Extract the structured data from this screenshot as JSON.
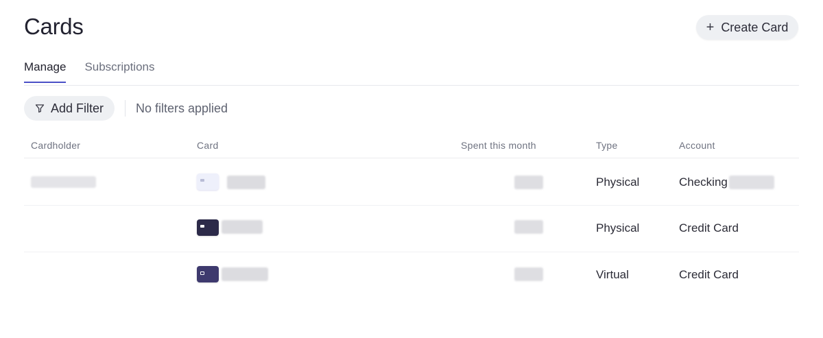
{
  "page": {
    "title": "Cards"
  },
  "header": {
    "create_button": {
      "label": "Create Card",
      "icon": "plus-icon"
    }
  },
  "tabs": [
    {
      "label": "Manage",
      "active": true
    },
    {
      "label": "Subscriptions",
      "active": false
    }
  ],
  "filters": {
    "add_filter_label": "Add Filter",
    "icon": "filter-icon",
    "status": "No filters applied"
  },
  "table": {
    "columns": [
      "Cardholder",
      "Card",
      "Spent this month",
      "Type",
      "Account"
    ],
    "rows": [
      {
        "cardholder": "",
        "card_style": "light",
        "type": "Physical",
        "account": "Checking"
      },
      {
        "cardholder": "",
        "card_style": "dark",
        "type": "Physical",
        "account": "Credit Card"
      },
      {
        "cardholder": "",
        "card_style": "purple",
        "type": "Virtual",
        "account": "Credit Card"
      }
    ]
  },
  "colors": {
    "accent": "#4a4fc7",
    "card_light": "#eef0fb",
    "card_dark": "#2c2a49",
    "card_purple": "#3e3a6e"
  }
}
